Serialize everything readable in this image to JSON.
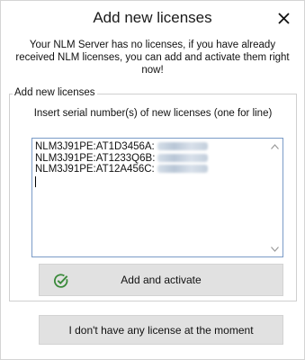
{
  "dialog": {
    "title": "Add new licenses",
    "intro": "Your NLM Server has no licenses, if you have already received NLM licenses, you can add and activate them right now!"
  },
  "group": {
    "legend": "Add new licenses",
    "instruction": "Insert serial number(s) of new licenses (one for line)"
  },
  "serials": [
    {
      "prefix": "NLM3J91PE:AT1D3456A:"
    },
    {
      "prefix": "NLM3J91PE:AT1233Q6B:"
    },
    {
      "prefix": "NLM3J91PE:AT12A456C:"
    }
  ],
  "buttons": {
    "add_activate": "Add and activate",
    "no_license": "I don't have any license at the moment"
  },
  "icons": {
    "close": "close-icon",
    "check": "check-circle-icon",
    "scroll_up": "chevron-up-icon",
    "scroll_down": "chevron-down-icon"
  },
  "colors": {
    "accent_green": "#3a8a3a",
    "button_bg": "#e1e1e1",
    "field_border": "#7a9bc7"
  }
}
